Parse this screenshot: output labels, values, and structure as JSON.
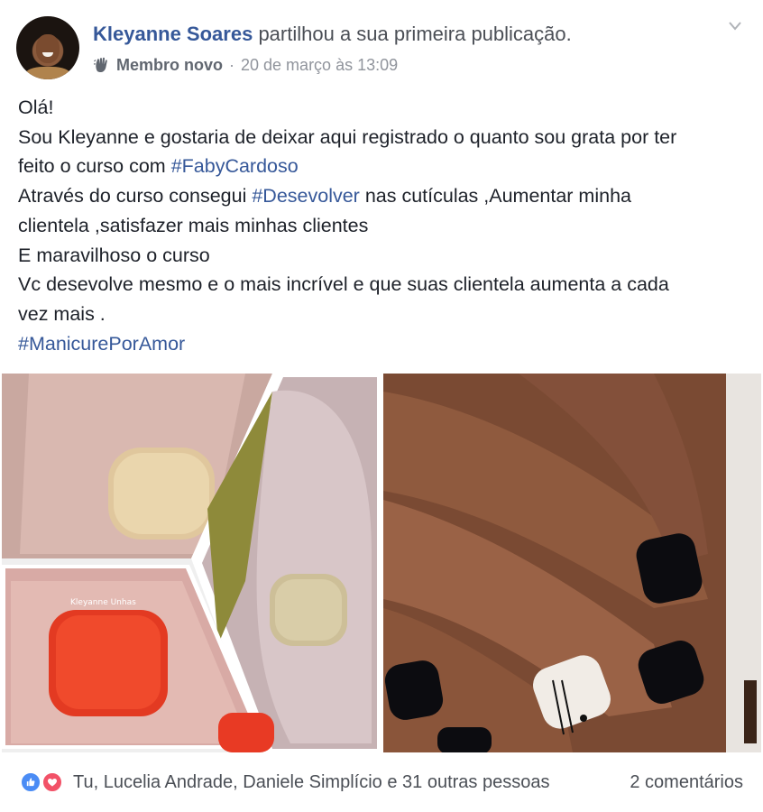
{
  "header": {
    "author_name": "Kleyanne Soares",
    "action_text": "partilhou a sua primeira publicação.",
    "badge_label": "Membro novo",
    "separator": "·",
    "timestamp": "20 de março às 13:09"
  },
  "post": {
    "lines": {
      "l1": "Olá!",
      "l2": "Sou Kleyanne e gostaria de deixar aqui registrado o quanto sou grata por ter",
      "l3_text": "feito o curso com ",
      "l3_tag": "#FabyCardoso",
      "l4_text_a": "Através do curso consegui ",
      "l4_tag": "#Desevolver",
      "l4_text_b": " nas cutículas ,Aumentar minha",
      "l5": "clientela ,satisfazer mais minhas clientes",
      "l6": "E maravilhoso o curso",
      "l7": "Vc desevolve mesmo e o mais incrível e que suas clientela aumenta a cada",
      "l8": "vez mais .",
      "l9_tag": "#ManicurePorAmor"
    }
  },
  "photos": {
    "left_watermark": "Kleyanne Unhas"
  },
  "footer": {
    "reactions_text": "Tu, Lucelia Andrade, Daniele Simplício e 31 outras pessoas",
    "comments_text": "2 comentários"
  },
  "colors": {
    "link": "#365899",
    "text": "#1d2129",
    "meta": "#90949c",
    "like": "#4b8cf5",
    "love": "#f25268"
  }
}
